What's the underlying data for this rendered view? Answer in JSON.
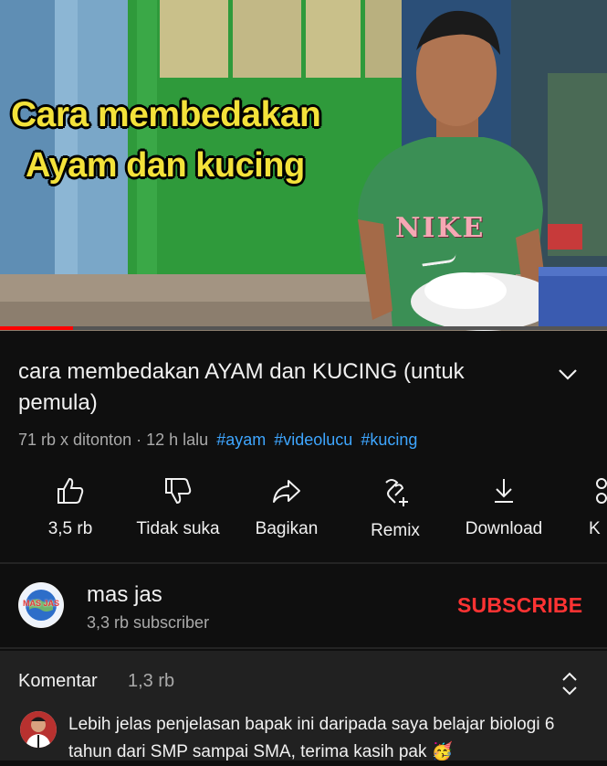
{
  "video": {
    "caption_line1": "Cara membedakan",
    "caption_line2": "Ayam dan kucing",
    "shirt_text": "NIKE",
    "progress_fraction": 0.12,
    "accent_color": "#ff0000"
  },
  "info": {
    "title": "cara membedakan AYAM dan KUCING (untuk pemula)",
    "views": "71 rb x ditonton",
    "separator": "·",
    "time": "12 h lalu",
    "hashtags": [
      "#ayam",
      "#videolucu",
      "#kucing"
    ],
    "hashtag_color": "#3ea6ff"
  },
  "actions": {
    "like": {
      "label": "3,5 rb",
      "icon": "thumbs-up-icon"
    },
    "dislike": {
      "label": "Tidak suka",
      "icon": "thumbs-down-icon"
    },
    "share": {
      "label": "Bagikan",
      "icon": "share-arrow-icon"
    },
    "remix": {
      "label": "Remix",
      "icon": "remix-icon"
    },
    "download": {
      "label": "Download",
      "icon": "download-icon"
    },
    "more": {
      "label": "K",
      "icon": "clip-icon"
    }
  },
  "channel": {
    "name": "mas jas",
    "subscribers": "3,3 rb subscriber",
    "subscribe_label": "SUBSCRIBE",
    "subscribe_color": "#ff3333",
    "avatar_text": "MAS JAS"
  },
  "comments": {
    "heading": "Komentar",
    "count": "1,3 rb",
    "top_comment": "Lebih jelas penjelasan bapak ini daripada saya belajar biologi 6 tahun dari SMP sampai SMA, terima kasih pak 🥳"
  }
}
